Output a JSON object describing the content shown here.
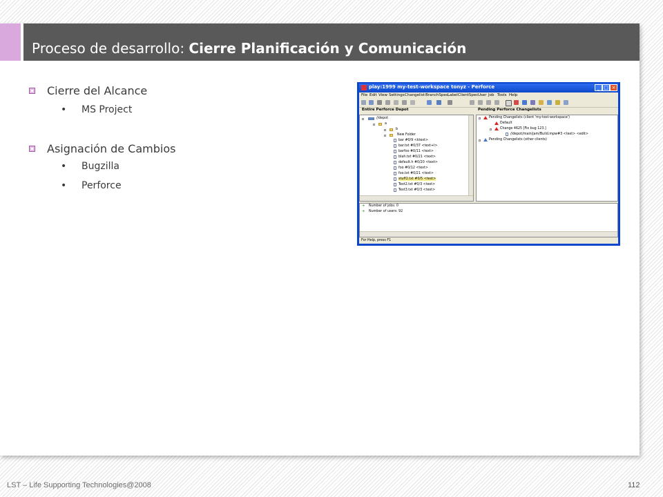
{
  "slide": {
    "title_normal": "Proceso de desarrollo: ",
    "title_bold": "Cierre Planificación y Comunicación",
    "sections": [
      {
        "label": "Cierre del Alcance",
        "items": [
          "MS Project"
        ]
      },
      {
        "label": "Asignación de Cambios",
        "items": [
          "Bugzilla",
          "Perforce"
        ]
      }
    ],
    "bullet_glyph": "•"
  },
  "screenshot": {
    "window_title": "play:1999 my-test-workspace tonyz - Perforce",
    "menu": [
      "File",
      "Edit",
      "View",
      "Settings",
      "Changelist",
      "BranchSpec",
      "Label",
      "ClientSpec",
      "User",
      "Job",
      "Tools",
      "Help"
    ],
    "left_pane_title": "Entire Perforce Depot",
    "right_pane_title": "Pending Perforce Changelists",
    "depot_tree": [
      "//depot",
      "a",
      "b",
      "New Folder",
      "bar #0/9 <ktext>",
      "bar.txt #0/37 <text+l>",
      "barfoo #0/11 <text>",
      "blah.txt #0/21 <text>",
      "default.h #0/20 <text>",
      "foo #0/12 <text>",
      "foo.txt #0/21 <text>",
      "stuff2.txt #0/5 <text>",
      "Text2.txt #0/3 <text>",
      "Text3.txt #0/3 <text>"
    ],
    "changelists": [
      "Pending Changelists (client 'my-test-workspace')",
      "Default",
      "Change 4625 [Fix bug 123.]",
      "//depot/main/jam/Build.mpw#3 <text> <edit>",
      "Pending Changelists (other clients)"
    ],
    "log": [
      "Number of jobs: 0",
      "Number of users: 92"
    ],
    "status": "For Help, press F1"
  },
  "footer": {
    "credit": "LST – Life Supporting Technologies@2008",
    "page": "112"
  },
  "colors": {
    "title_bar": "#595959",
    "accent": "#d9a8dd",
    "bullet_square": "#e6bde8",
    "text": "#3a3a3a",
    "xp_blue": "#0a46cc"
  }
}
